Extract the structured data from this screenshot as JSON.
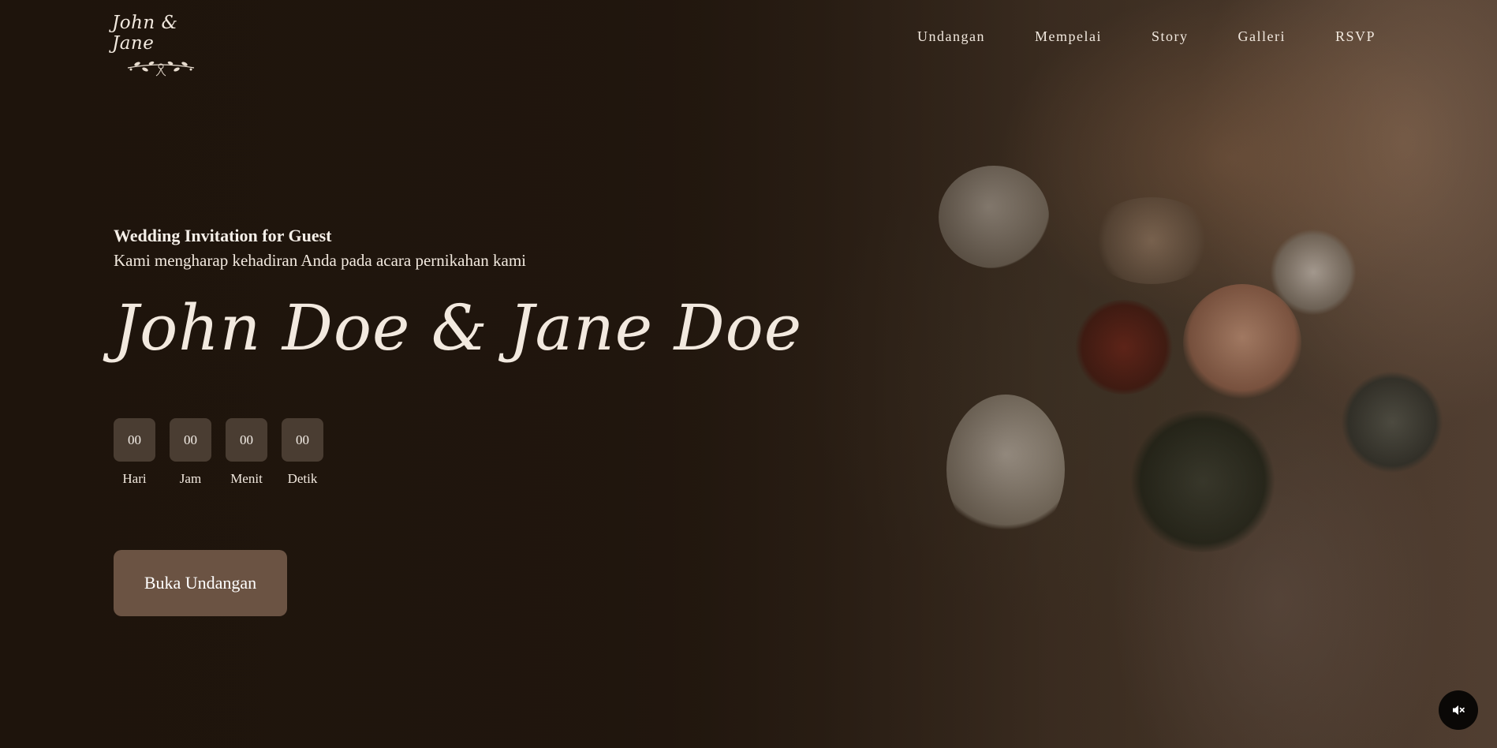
{
  "logo": {
    "text": "John & Jane",
    "ornament_icon": "floral-ornament"
  },
  "nav": {
    "items": [
      {
        "label": "Undangan"
      },
      {
        "label": "Mempelai"
      },
      {
        "label": "Story"
      },
      {
        "label": "Galleri"
      },
      {
        "label": "RSVP"
      }
    ]
  },
  "hero": {
    "headline": "Wedding Invitation for Guest",
    "subline": "Kami mengharap kehadiran Anda pada acara pernikahan kami",
    "couple_names": "John Doe & Jane Doe"
  },
  "countdown": {
    "units": [
      {
        "value": "00",
        "label": "Hari"
      },
      {
        "value": "00",
        "label": "Jam"
      },
      {
        "value": "00",
        "label": "Menit"
      },
      {
        "value": "00",
        "label": "Detik"
      }
    ]
  },
  "cta": {
    "open_label": "Buka Undangan"
  },
  "audio": {
    "icon": "speaker-muted-icon"
  },
  "colors": {
    "background": "#221810",
    "text": "#f2e9df",
    "button": "#6b5343",
    "countdown_box": "#5a4b3f"
  }
}
